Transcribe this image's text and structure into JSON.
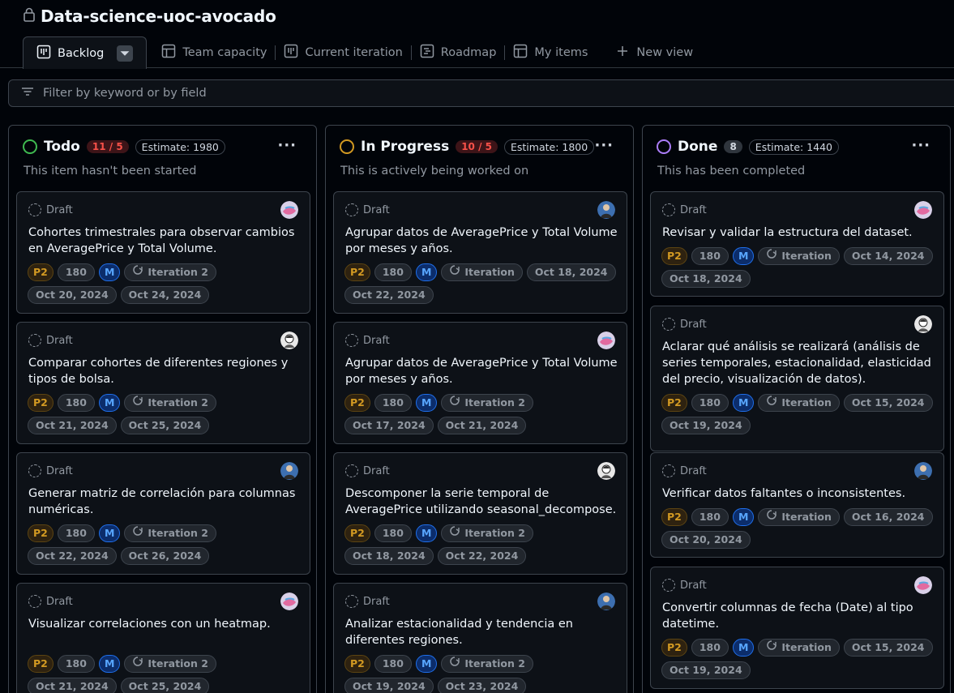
{
  "project": {
    "title": "Data-science-uoc-avocado"
  },
  "tabs": [
    {
      "label": "Backlog"
    },
    {
      "label": "Team capacity"
    },
    {
      "label": "Current iteration"
    },
    {
      "label": "Roadmap"
    },
    {
      "label": "My items"
    },
    {
      "label": "New view"
    }
  ],
  "filter": {
    "placeholder": "Filter by keyword or by field"
  },
  "columns": [
    {
      "title": "Todo",
      "count": "11 / 5",
      "estimate": "Estimate: 1980",
      "description": "This item hasn't been started",
      "color": "#3fb950",
      "cards": [
        {
          "type": "Draft",
          "title": "Cohortes trimestrales para observar cambios en AveragePrice y Total Volume.",
          "priority": "P2",
          "estimate": "180",
          "size": "M",
          "iteration": "Iteration 2",
          "start": "Oct 20, 2024",
          "end": "Oct 24, 2024",
          "avatar": "avatar-pink"
        },
        {
          "type": "Draft",
          "title": "Comparar cohortes de diferentes regiones y tipos de bolsa.",
          "priority": "P2",
          "estimate": "180",
          "size": "M",
          "iteration": "Iteration 2",
          "start": "Oct 21, 2024",
          "end": "Oct 25, 2024",
          "avatar": "avatar-bw"
        },
        {
          "type": "Draft",
          "title": "Generar matriz de correlación para columnas numéricas.",
          "priority": "P2",
          "estimate": "180",
          "size": "M",
          "iteration": "Iteration 2",
          "start": "Oct 22, 2024",
          "end": "Oct 26, 2024",
          "avatar": "avatar-blue"
        },
        {
          "type": "Draft",
          "title": "Visualizar correlaciones con un heatmap.",
          "priority": "P2",
          "estimate": "180",
          "size": "M",
          "iteration": "Iteration 2",
          "start": "Oct 21, 2024",
          "end": "Oct 25, 2024",
          "avatar": "avatar-pink"
        }
      ]
    },
    {
      "title": "In Progress",
      "count": "10 / 5",
      "estimate": "Estimate: 1800",
      "description": "This is actively being worked on",
      "color": "#d29922",
      "cards": [
        {
          "type": "Draft",
          "title": "Agrupar datos de AveragePrice y Total Volume por meses y años.",
          "priority": "P2",
          "estimate": "180",
          "size": "M",
          "iteration": "Iteration",
          "start": "Oct 18, 2024",
          "end": "Oct 22, 2024",
          "avatar": "avatar-blue"
        },
        {
          "type": "Draft",
          "title": "Agrupar datos de AveragePrice y Total Volume por meses y años.",
          "priority": "P2",
          "estimate": "180",
          "size": "M",
          "iteration": "Iteration 2",
          "start": "Oct 17, 2024",
          "end": "Oct 21, 2024",
          "avatar": "avatar-pink"
        },
        {
          "type": "Draft",
          "title": "Descomponer la serie temporal de AveragePrice utilizando seasonal_decompose.",
          "priority": "P2",
          "estimate": "180",
          "size": "M",
          "iteration": "Iteration 2",
          "start": "Oct 18, 2024",
          "end": "Oct 22, 2024",
          "avatar": "avatar-bw"
        },
        {
          "type": "Draft",
          "title": "Analizar estacionalidad y tendencia en diferentes regiones.",
          "priority": "P2",
          "estimate": "180",
          "size": "M",
          "iteration": "Iteration 2",
          "start": "Oct 19, 2024",
          "end": "Oct 23, 2024",
          "avatar": "avatar-blue"
        }
      ]
    },
    {
      "title": "Done",
      "count": "8",
      "estimate": "Estimate: 1440",
      "description": "This has been completed",
      "color": "#ab7df8",
      "cards": [
        {
          "type": "Draft",
          "title": "Revisar y validar la estructura del dataset.",
          "priority": "P2",
          "estimate": "180",
          "size": "M",
          "iteration": "Iteration",
          "start": "Oct 14, 2024",
          "end": "Oct 18, 2024",
          "avatar": "avatar-pink"
        },
        {
          "type": "Draft",
          "title": "Aclarar qué análisis se realizará (análisis de series temporales, estacionalidad, elasticidad del precio, visualización de datos).",
          "priority": "P2",
          "estimate": "180",
          "size": "M",
          "iteration": "Iteration",
          "start": "Oct 15, 2024",
          "end": "Oct 19, 2024",
          "avatar": "avatar-bw"
        },
        {
          "type": "Draft",
          "title": "Verificar datos faltantes o inconsistentes.",
          "priority": "P2",
          "estimate": "180",
          "size": "M",
          "iteration": "Iteration",
          "start": "Oct 16, 2024",
          "end": "Oct 20, 2024",
          "avatar": "avatar-blue"
        },
        {
          "type": "Draft",
          "title": "Convertir columnas de fecha (Date) al tipo datetime.",
          "priority": "P2",
          "estimate": "180",
          "size": "M",
          "iteration": "Iteration",
          "start": "Oct 15, 2024",
          "end": "Oct 19, 2024",
          "avatar": "avatar-pink"
        }
      ]
    }
  ]
}
